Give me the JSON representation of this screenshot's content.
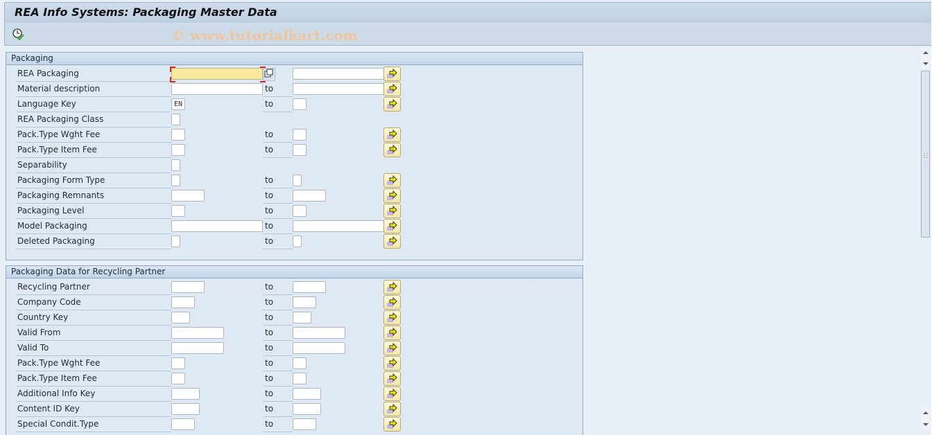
{
  "window": {
    "title": "REA Info Systems: Packaging Master Data",
    "watermark": "© www.tutorialkart.com"
  },
  "toolbar": {
    "execute_icon": "execute-clock-check-icon"
  },
  "range_label": "to",
  "groups": [
    {
      "title": "Packaging",
      "rows": [
        {
          "label": "REA Packaging",
          "low": "",
          "high": "",
          "has_range": true,
          "to_label": false,
          "focused": true,
          "matchcode": true
        },
        {
          "label": "Material description",
          "low": "",
          "high": "",
          "has_range": true
        },
        {
          "label": "Language Key",
          "low": "EN",
          "high": "",
          "has_range": true
        },
        {
          "label": "REA Packaging Class",
          "low": "",
          "has_range": false
        },
        {
          "label": "Pack.Type Wght Fee",
          "low": "",
          "high": "",
          "has_range": true
        },
        {
          "label": "Pack.Type Item Fee",
          "low": "",
          "high": "",
          "has_range": true
        },
        {
          "label": "Separability",
          "low": "",
          "has_range": false
        },
        {
          "label": "Packaging Form Type",
          "low": "",
          "high": "",
          "has_range": true
        },
        {
          "label": "Packaging Remnants",
          "low": "",
          "high": "",
          "has_range": true
        },
        {
          "label": "Packaging Level",
          "low": "",
          "high": "",
          "has_range": true
        },
        {
          "label": "Model Packaging",
          "low": "",
          "high": "",
          "has_range": true
        },
        {
          "label": "Deleted Packaging",
          "low": "",
          "high": "",
          "has_range": true
        }
      ]
    },
    {
      "title": "Packaging Data for Recycling Partner",
      "rows": [
        {
          "label": "Recycling Partner",
          "low": "",
          "high": "",
          "has_range": true
        },
        {
          "label": "Company Code",
          "low": "",
          "high": "",
          "has_range": true
        },
        {
          "label": "Country Key",
          "low": "",
          "high": "",
          "has_range": true
        },
        {
          "label": "Valid From",
          "low": "",
          "high": "",
          "has_range": true
        },
        {
          "label": "Valid To",
          "low": "",
          "high": "",
          "has_range": true
        },
        {
          "label": "Pack.Type Wght Fee",
          "low": "",
          "high": "",
          "has_range": true
        },
        {
          "label": "Pack.Type Item Fee",
          "low": "",
          "high": "",
          "has_range": true
        },
        {
          "label": "Additional Info Key",
          "low": "",
          "high": "",
          "has_range": true
        },
        {
          "label": "Content ID Key",
          "low": "",
          "high": "",
          "has_range": true
        },
        {
          "label": "Special Condit.Type",
          "low": "",
          "high": "",
          "has_range": true
        }
      ]
    }
  ],
  "scrollbar": {
    "up_icon": "scroll-up-arrow-icon",
    "down_icon": "scroll-down-arrow-icon"
  }
}
